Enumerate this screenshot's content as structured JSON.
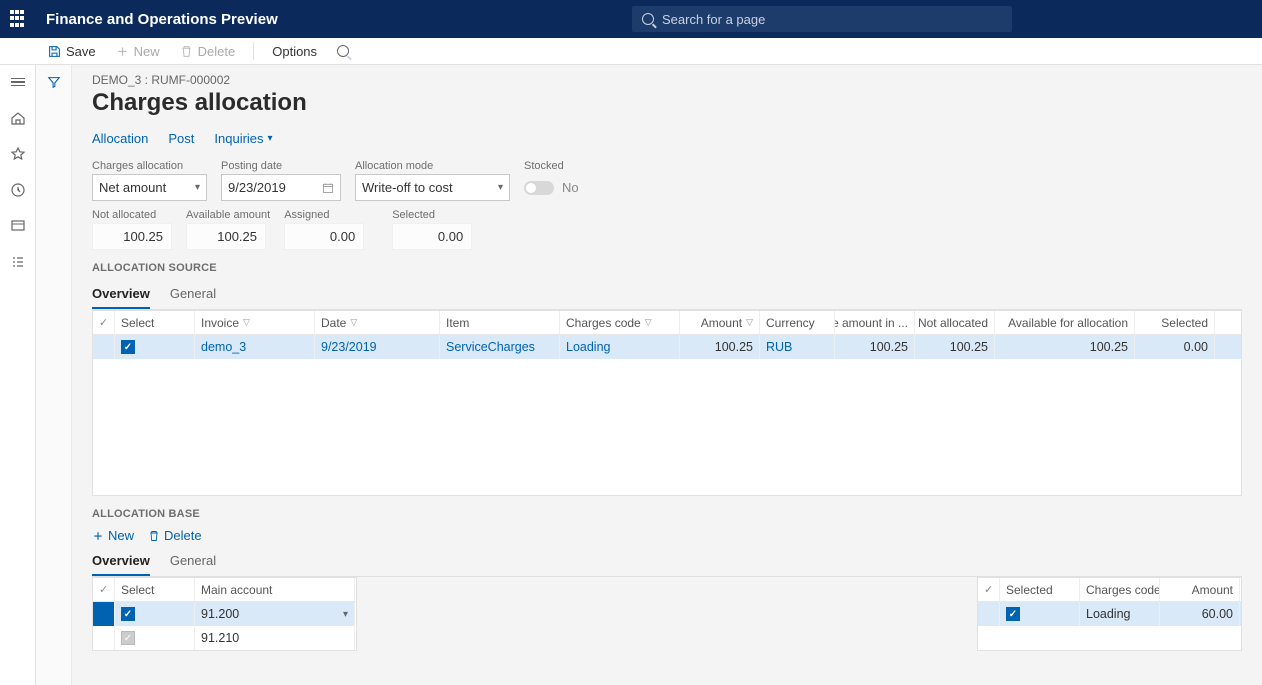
{
  "header": {
    "title": "Finance and Operations Preview",
    "search_placeholder": "Search for a page"
  },
  "commandbar": {
    "save": "Save",
    "new": "New",
    "delete": "Delete",
    "options": "Options"
  },
  "page": {
    "breadcrumb": "DEMO_3 : RUMF-000002",
    "title": "Charges allocation"
  },
  "actions": {
    "allocation": "Allocation",
    "post": "Post",
    "inquiries": "Inquiries"
  },
  "fields": {
    "charges_allocation_label": "Charges allocation",
    "charges_allocation_value": "Net amount",
    "posting_date_label": "Posting date",
    "posting_date_value": "9/23/2019",
    "allocation_mode_label": "Allocation mode",
    "allocation_mode_value": "Write-off to cost",
    "stocked_label": "Stocked",
    "stocked_value": "No"
  },
  "summary": {
    "not_allocated_label": "Not allocated",
    "not_allocated_value": "100.25",
    "available_label": "Available amount",
    "available_value": "100.25",
    "assigned_label": "Assigned",
    "assigned_value": "0.00",
    "selected_label": "Selected",
    "selected_value": "0.00"
  },
  "sections": {
    "source": "ALLOCATION SOURCE",
    "base": "ALLOCATION BASE"
  },
  "tabs": {
    "overview": "Overview",
    "general": "General"
  },
  "source_grid": {
    "cols": {
      "select": "Select",
      "invoice": "Invoice",
      "date": "Date",
      "item": "Item",
      "charges_code": "Charges code",
      "amount": "Amount",
      "currency": "Currency",
      "amount_in": "The amount in ...",
      "not_allocated": "Not allocated",
      "available_for_allocation": "Available for allocation",
      "selected": "Selected"
    },
    "row": {
      "invoice": "demo_3",
      "date": "9/23/2019",
      "item": "ServiceCharges",
      "charges_code": "Loading",
      "amount": "100.25",
      "currency": "RUB",
      "amount_in": "100.25",
      "not_allocated": "100.25",
      "available_for_allocation": "100.25",
      "selected": "0.00"
    }
  },
  "base_toolbar": {
    "new": "New",
    "delete": "Delete"
  },
  "base_grid": {
    "cols": {
      "select": "Select",
      "main_account": "Main account"
    },
    "row1": {
      "main_account": "91.200"
    },
    "row2": {
      "main_account": "91.210"
    }
  },
  "right_grid": {
    "cols": {
      "selected": "Selected",
      "charges_code": "Charges code",
      "amount": "Amount"
    },
    "row": {
      "charges_code": "Loading",
      "amount": "60.00"
    }
  }
}
